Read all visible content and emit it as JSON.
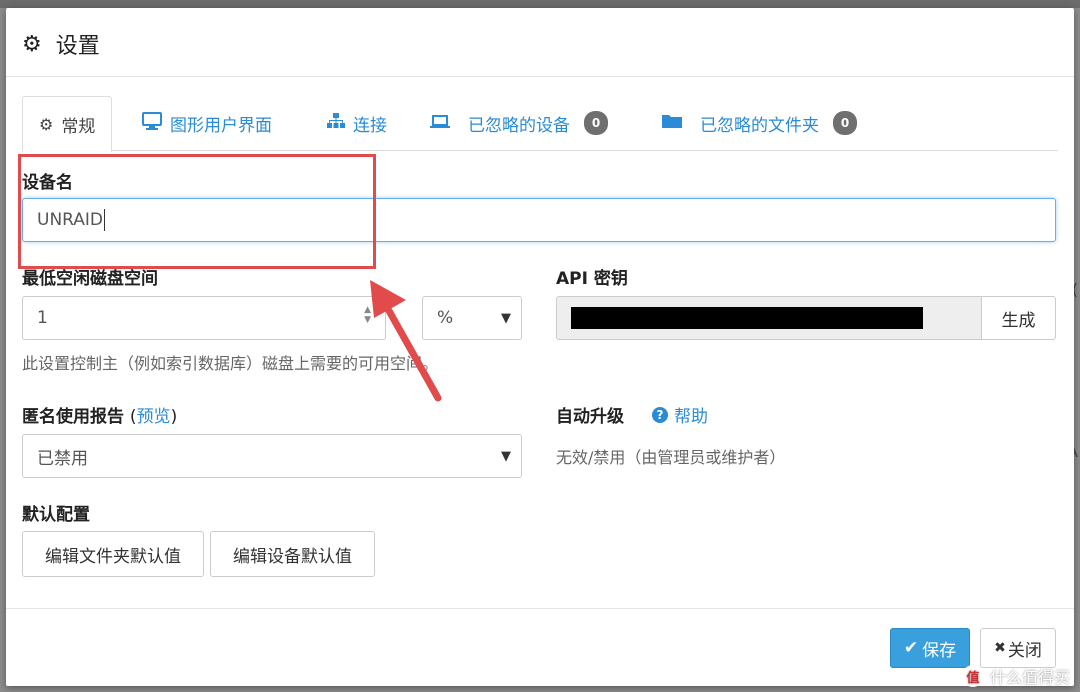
{
  "dialog": {
    "title": "设置"
  },
  "tabs": [
    {
      "label": "常规",
      "icon": "gear-icon"
    },
    {
      "label": "图形用户界面",
      "icon": "monitor-icon"
    },
    {
      "label": "连接",
      "icon": "sitemap-icon"
    },
    {
      "label": "已忽略的设备",
      "icon": "laptop-icon",
      "badge": "0"
    },
    {
      "label": "已忽略的文件夹",
      "icon": "folder-icon",
      "badge": "0"
    }
  ],
  "general": {
    "device_name_label": "设备名",
    "device_name_value": "UNRAID",
    "min_disk_label": "最低空闲磁盘空间",
    "min_disk_value": "1",
    "min_disk_unit": "%",
    "min_disk_help": "此设置控制主（例如索引数据库）磁盘上需要的可用空间。",
    "api_key_label": "API 密钥",
    "api_generate": "生成",
    "usage_label": "匿名使用报告",
    "usage_preview": "预览",
    "usage_value": "已禁用",
    "auto_upgrade_label": "自动升级",
    "auto_upgrade_help": "帮助",
    "auto_upgrade_value": "无效/禁用（由管理员或维护者）",
    "default_config_label": "默认配置",
    "edit_folder_defaults": "编辑文件夹默认值",
    "edit_device_defaults": "编辑设备默认值"
  },
  "footer": {
    "save": "保存",
    "close": "关闭"
  },
  "watermark": {
    "logo": "值",
    "text": "什么值得买"
  },
  "colors": {
    "accent": "#3aa0dd",
    "link": "#2a8bd6",
    "annotation_red": "#e24b4b"
  }
}
